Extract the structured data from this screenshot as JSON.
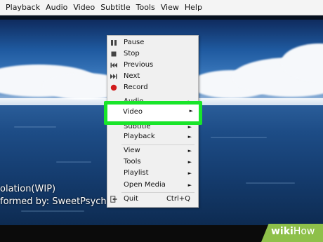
{
  "menubar": {
    "items": [
      "Playback",
      "Audio",
      "Video",
      "Subtitle",
      "Tools",
      "View",
      "Help"
    ]
  },
  "overlay_text": {
    "line1": "olation(WIP)",
    "line2": "formed by: SweetPsyche"
  },
  "context_menu": {
    "items": [
      {
        "label": "Pause",
        "icon": "pause-icon"
      },
      {
        "label": "Stop",
        "icon": "stop-icon"
      },
      {
        "label": "Previous",
        "icon": "previous-icon"
      },
      {
        "label": "Next",
        "icon": "next-icon"
      },
      {
        "label": "Record",
        "icon": "record-icon"
      },
      {
        "label": "Audio",
        "icon": "",
        "submenu": true
      },
      {
        "label": "Video",
        "icon": "",
        "submenu": true,
        "highlighted": true
      },
      {
        "label": "Subtitle",
        "icon": "",
        "submenu": true
      },
      {
        "label": "Playback",
        "icon": "",
        "submenu": true
      },
      {
        "label": "View",
        "icon": "",
        "submenu": true
      },
      {
        "label": "Tools",
        "icon": "",
        "submenu": true
      },
      {
        "label": "Playlist",
        "icon": "",
        "submenu": true
      },
      {
        "label": "Open Media",
        "icon": "",
        "submenu": true
      },
      {
        "label": "Quit",
        "icon": "quit-icon",
        "shortcut": "Ctrl+Q"
      }
    ],
    "submenu_arrow": "►"
  },
  "watermark": {
    "text_wiki": "wiki",
    "text_how": "How",
    "color": "#8ec04a"
  },
  "colors": {
    "highlight_frame": "#19e52a",
    "record_dot": "#d11b1b"
  }
}
